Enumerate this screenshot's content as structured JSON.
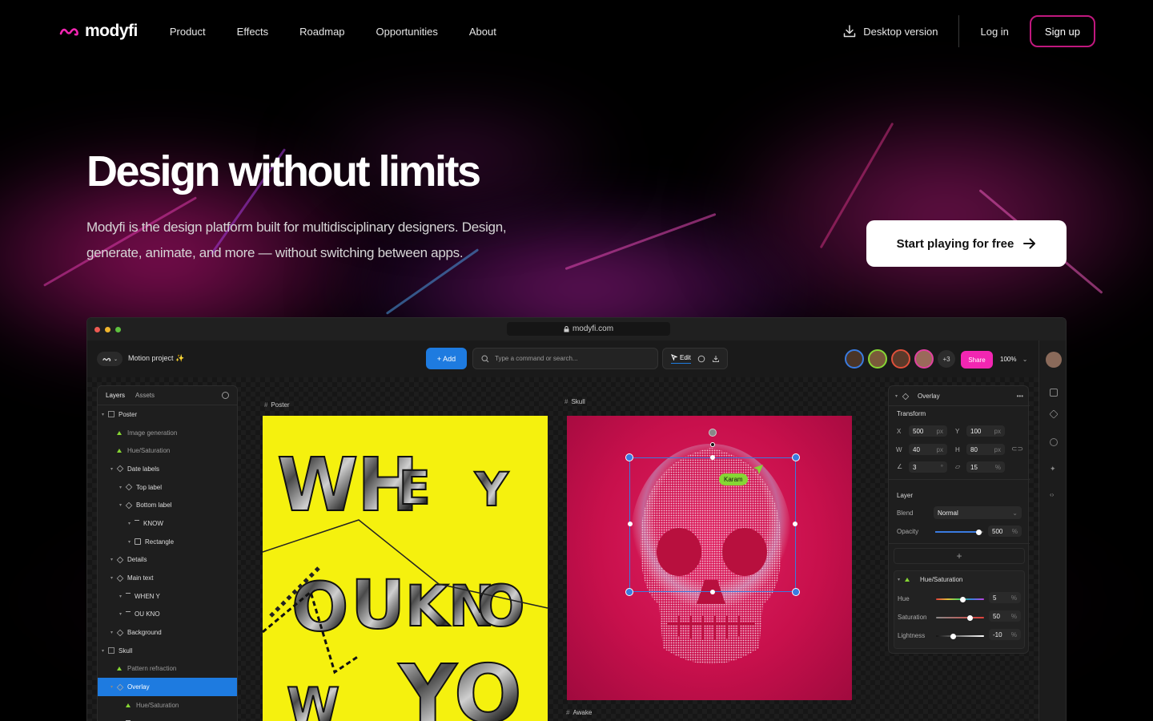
{
  "nav": {
    "logo": "modyfi",
    "links": [
      "Product",
      "Effects",
      "Roadmap",
      "Opportunities",
      "About"
    ],
    "desktop_version": "Desktop version",
    "login": "Log in",
    "signup": "Sign up"
  },
  "hero": {
    "title": "Design without limits",
    "subtitle": "Modyfi is the design platform built for multidisciplinary designers. Design, generate, animate, and more — without switching between apps.",
    "cta": "Start playing for free"
  },
  "app": {
    "url": "modyfi.com",
    "project_title": "Motion project ✨",
    "add_label": "+ Add",
    "search_placeholder": "Type a command or search...",
    "edit_label": "Edit",
    "more_collaborators": "+3",
    "share_label": "Share",
    "zoom": "100%",
    "layers_panel": {
      "tabs": [
        "Layers",
        "Assets"
      ],
      "items": [
        {
          "label": "Poster",
          "icon": "frame",
          "indent": 0,
          "dim": false,
          "selected": false
        },
        {
          "label": "Image generation",
          "icon": "fx",
          "indent": 1,
          "dim": true,
          "selected": false
        },
        {
          "label": "Hue/Saturation",
          "icon": "fx",
          "indent": 1,
          "dim": true,
          "selected": false
        },
        {
          "label": "Date labels",
          "icon": "grp",
          "indent": 1,
          "dim": false,
          "selected": false
        },
        {
          "label": "Top label",
          "icon": "grp",
          "indent": 2,
          "dim": false,
          "selected": false
        },
        {
          "label": "Bottom label",
          "icon": "grp",
          "indent": 2,
          "dim": false,
          "selected": false
        },
        {
          "label": "KNOW",
          "icon": "txt",
          "indent": 3,
          "dim": false,
          "selected": false
        },
        {
          "label": "Rectangle",
          "icon": "rect",
          "indent": 3,
          "dim": false,
          "selected": false
        },
        {
          "label": "Details",
          "icon": "grp",
          "indent": 1,
          "dim": false,
          "selected": false
        },
        {
          "label": "Main text",
          "icon": "grp",
          "indent": 1,
          "dim": false,
          "selected": false
        },
        {
          "label": "WHEN Y",
          "icon": "txt",
          "indent": 2,
          "dim": false,
          "selected": false
        },
        {
          "label": "OU KNO",
          "icon": "txt",
          "indent": 2,
          "dim": false,
          "selected": false
        },
        {
          "label": "Background",
          "icon": "grp",
          "indent": 1,
          "dim": false,
          "selected": false
        },
        {
          "label": "Skull",
          "icon": "frame",
          "indent": 0,
          "dim": false,
          "selected": false
        },
        {
          "label": "Pattern refraction",
          "icon": "fx",
          "indent": 1,
          "dim": true,
          "selected": false
        },
        {
          "label": "Overlay",
          "icon": "grp",
          "indent": 1,
          "dim": false,
          "selected": true
        },
        {
          "label": "Hue/Saturation",
          "icon": "fx",
          "indent": 2,
          "dim": true,
          "selected": false
        },
        {
          "label": "Brush",
          "icon": "txt",
          "indent": 2,
          "dim": false,
          "selected": false
        }
      ]
    },
    "frames": {
      "poster": "Poster",
      "skull": "Skull",
      "awake": "Awake"
    },
    "collaborator_cursor": "Karam",
    "properties": {
      "layer_name": "Overlay",
      "transform_title": "Transform",
      "x": "500",
      "y": "100",
      "w": "40",
      "h": "80",
      "rotation": "3",
      "skew": "15",
      "px": "px",
      "deg": "°",
      "pct": "%",
      "layer_title": "Layer",
      "blend_label": "Blend",
      "blend_value": "Normal",
      "opacity_label": "Opacity",
      "opacity_value": "500",
      "opacity_level": 0.9,
      "effect_title": "Hue/Saturation",
      "hue_label": "Hue",
      "hue_value": "5",
      "hue_level": 0.55,
      "sat_label": "Saturation",
      "sat_value": "50",
      "sat_level": 0.7,
      "light_label": "Lightness",
      "light_value": "-10",
      "light_level": 0.35
    }
  },
  "colors": {
    "brand_pink": "#f226b2",
    "accent_blue": "#1e7be0",
    "poster_yellow": "#f5f10e",
    "skull_red": "#d01454",
    "signup_border": "#c0187e"
  }
}
